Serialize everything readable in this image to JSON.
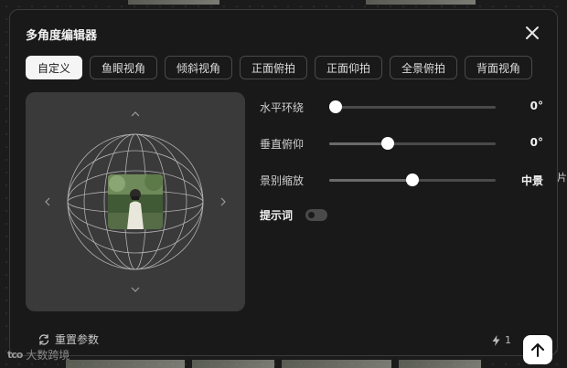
{
  "dialog": {
    "title": "多角度编辑器",
    "close_icon": "close-icon"
  },
  "tabs": [
    {
      "label": "自定义",
      "active": true
    },
    {
      "label": "鱼眼视角",
      "active": false
    },
    {
      "label": "倾斜视角",
      "active": false
    },
    {
      "label": "正面俯拍",
      "active": false
    },
    {
      "label": "正面仰拍",
      "active": false
    },
    {
      "label": "全景俯拍",
      "active": false
    },
    {
      "label": "背面视角",
      "active": false
    }
  ],
  "preview": {
    "icons": [
      "chevron-up-icon",
      "chevron-down-icon",
      "chevron-left-icon",
      "chevron-right-icon",
      "globe-grid-icon"
    ]
  },
  "sliders": [
    {
      "label": "水平环绕",
      "value": "0°",
      "position": 0.04
    },
    {
      "label": "垂直俯仰",
      "value": "0°",
      "position": 0.35
    },
    {
      "label": "景别缩放",
      "value": "中景",
      "position": 0.5
    }
  ],
  "prompt": {
    "label": "提示词",
    "enabled": false
  },
  "footer": {
    "reset_label": "重置参数",
    "credits": "1",
    "submit_icon": "arrow-up-icon"
  },
  "background": {
    "edge_text": "片",
    "watermark_logo": "tco",
    "watermark_text": "大数跨境"
  },
  "colors": {
    "dialog_bg": "#191919",
    "panel_bg": "#3a3a3a",
    "active_tab": "#f5f5f5",
    "border": "#4a4a4a"
  }
}
